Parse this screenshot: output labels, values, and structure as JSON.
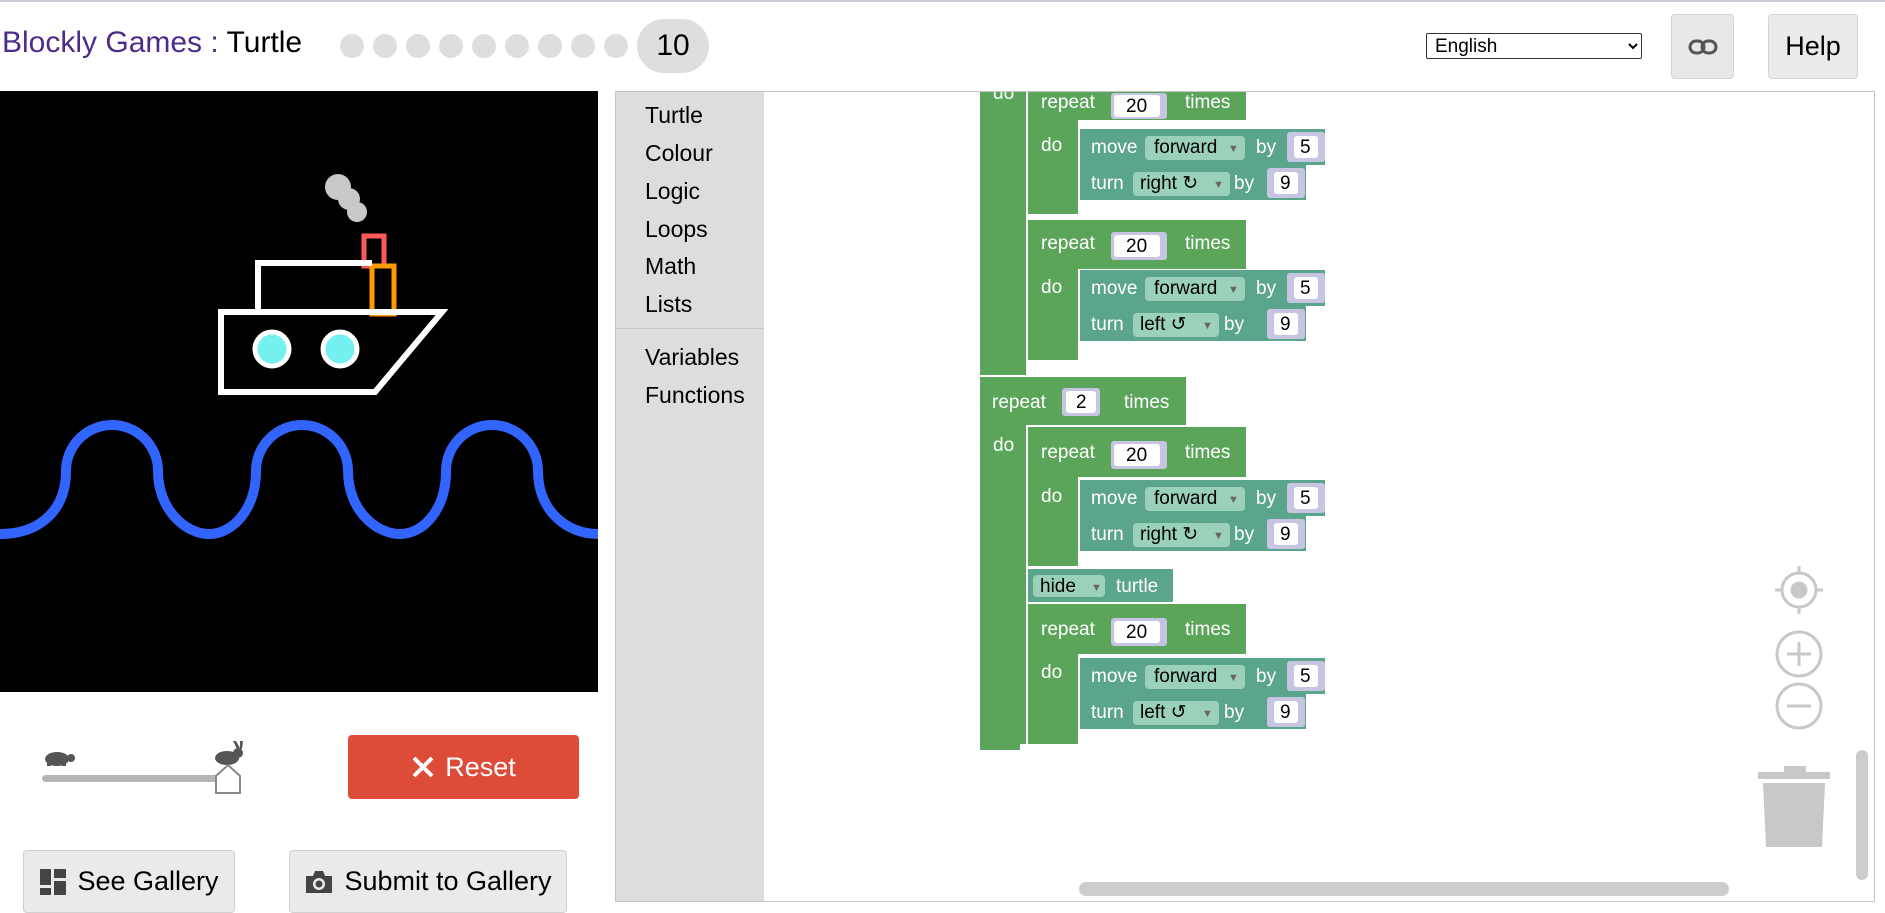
{
  "header": {
    "brand": "Blockly Games",
    "separator": ":",
    "game": "Turtle",
    "current_level": "10",
    "language": "English",
    "help_label": "Help"
  },
  "controls": {
    "reset_label": "Reset",
    "see_gallery_label": "See Gallery",
    "submit_gallery_label": "Submit to Gallery"
  },
  "toolbox": {
    "categories": [
      "Turtle",
      "Colour",
      "Logic",
      "Loops",
      "Math",
      "Lists",
      "Variables",
      "Functions"
    ]
  },
  "blocks": {
    "do": "do",
    "repeat": "repeat",
    "times": "times",
    "move": "move",
    "forward": "forward",
    "by": "by",
    "turn": "turn",
    "right": "right ↻",
    "left": "left ↺",
    "hide": "hide",
    "turtle": "turtle",
    "n20": "20",
    "n2": "2",
    "n5": "5",
    "n9": "9"
  },
  "colors": {
    "loop_green": "#5ba55b",
    "turtle_teal": "#5ba58c",
    "value_block": "#c6c6e3",
    "brand_purple": "#4b2c8b",
    "reset_red": "#dd4b39",
    "wave_blue": "#3264ff"
  }
}
